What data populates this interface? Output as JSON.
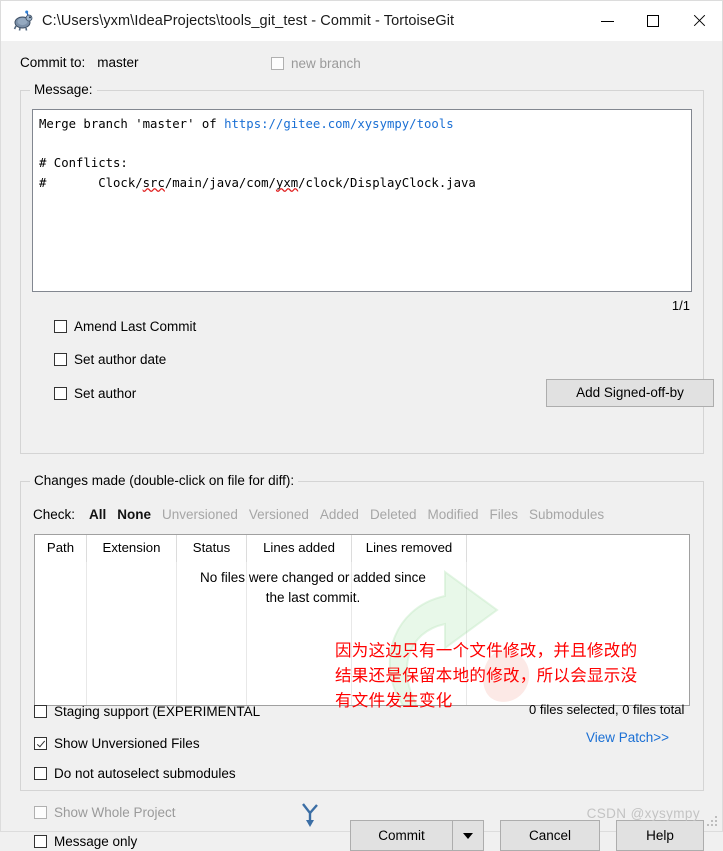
{
  "window": {
    "title": "C:\\Users\\yxm\\IdeaProjects\\tools_git_test - Commit - TortoiseGit",
    "app_icon": "tortoisegit-turtle-icon",
    "minimize_label": "—",
    "maximize_label": "□",
    "close_label": "✕"
  },
  "commit_to": {
    "label": "Commit to:",
    "branch": "master",
    "new_branch_label": "new branch",
    "new_branch_checked": false,
    "new_branch_disabled": true
  },
  "message": {
    "group_title": "Message:",
    "line1_prefix": "Merge branch 'master' of ",
    "line1_url": "https://gitee.com/xysympy/tools",
    "line3": "# Conflicts:",
    "line4_prefix": "#       Clock/",
    "line4_squiggle1": "src",
    "line4_mid": "/main/java/com/",
    "line4_squiggle2": "yxm",
    "line4_suffix": "/clock/DisplayClock.java",
    "page_indicator": "1/1"
  },
  "options": {
    "amend_last_commit": "Amend Last Commit",
    "amend_checked": false,
    "set_author_date": "Set author date",
    "set_author_date_checked": false,
    "set_author": "Set author",
    "set_author_checked": false,
    "add_signed_off_by": "Add Signed-off-by"
  },
  "changes": {
    "group_title": "Changes made (double-click on file for diff):",
    "check_label": "Check:",
    "filters": [
      {
        "label": "All",
        "active": true
      },
      {
        "label": "None",
        "active": true
      },
      {
        "label": "Unversioned",
        "active": false
      },
      {
        "label": "Versioned",
        "active": false
      },
      {
        "label": "Added",
        "active": false
      },
      {
        "label": "Deleted",
        "active": false
      },
      {
        "label": "Modified",
        "active": false
      },
      {
        "label": "Files",
        "active": false
      },
      {
        "label": "Submodules",
        "active": false
      }
    ],
    "columns": [
      "Path",
      "Extension",
      "Status",
      "Lines added",
      "Lines removed"
    ],
    "empty_message_line1": "No files were changed or added since",
    "empty_message_line2": "the last commit.",
    "files_total": "0 files selected, 0 files total",
    "view_patch": "View Patch>>"
  },
  "annotation": {
    "line1": "因为这边只有一个文件修改，并且修改的",
    "line2": "结果还是保留本地的修改，所以会显示没",
    "line3": "有文件发生变化",
    "color": "#ff0000"
  },
  "bottom_options": {
    "staging_support": "Staging support (EXPERIMENTAL",
    "staging_checked": false,
    "show_unversioned": "Show Unversioned Files",
    "show_unversioned_checked": true,
    "no_autoselect_submodules": "Do not autoselect submodules",
    "no_autoselect_checked": false,
    "show_whole_project": "Show Whole Project",
    "show_whole_project_checked": false,
    "show_whole_project_disabled": true,
    "message_only": "Message only",
    "message_only_checked": false
  },
  "buttons": {
    "commit": "Commit",
    "commit_accel": "o",
    "cancel": "Cancel",
    "help": "Help"
  },
  "watermark": {
    "text": "CSDN @xysympy"
  },
  "colors": {
    "link": "#1a6fd4",
    "annotation_red": "#ff0000",
    "disabled_text": "#9a9a9a",
    "window_bg": "#f0f0f0"
  }
}
